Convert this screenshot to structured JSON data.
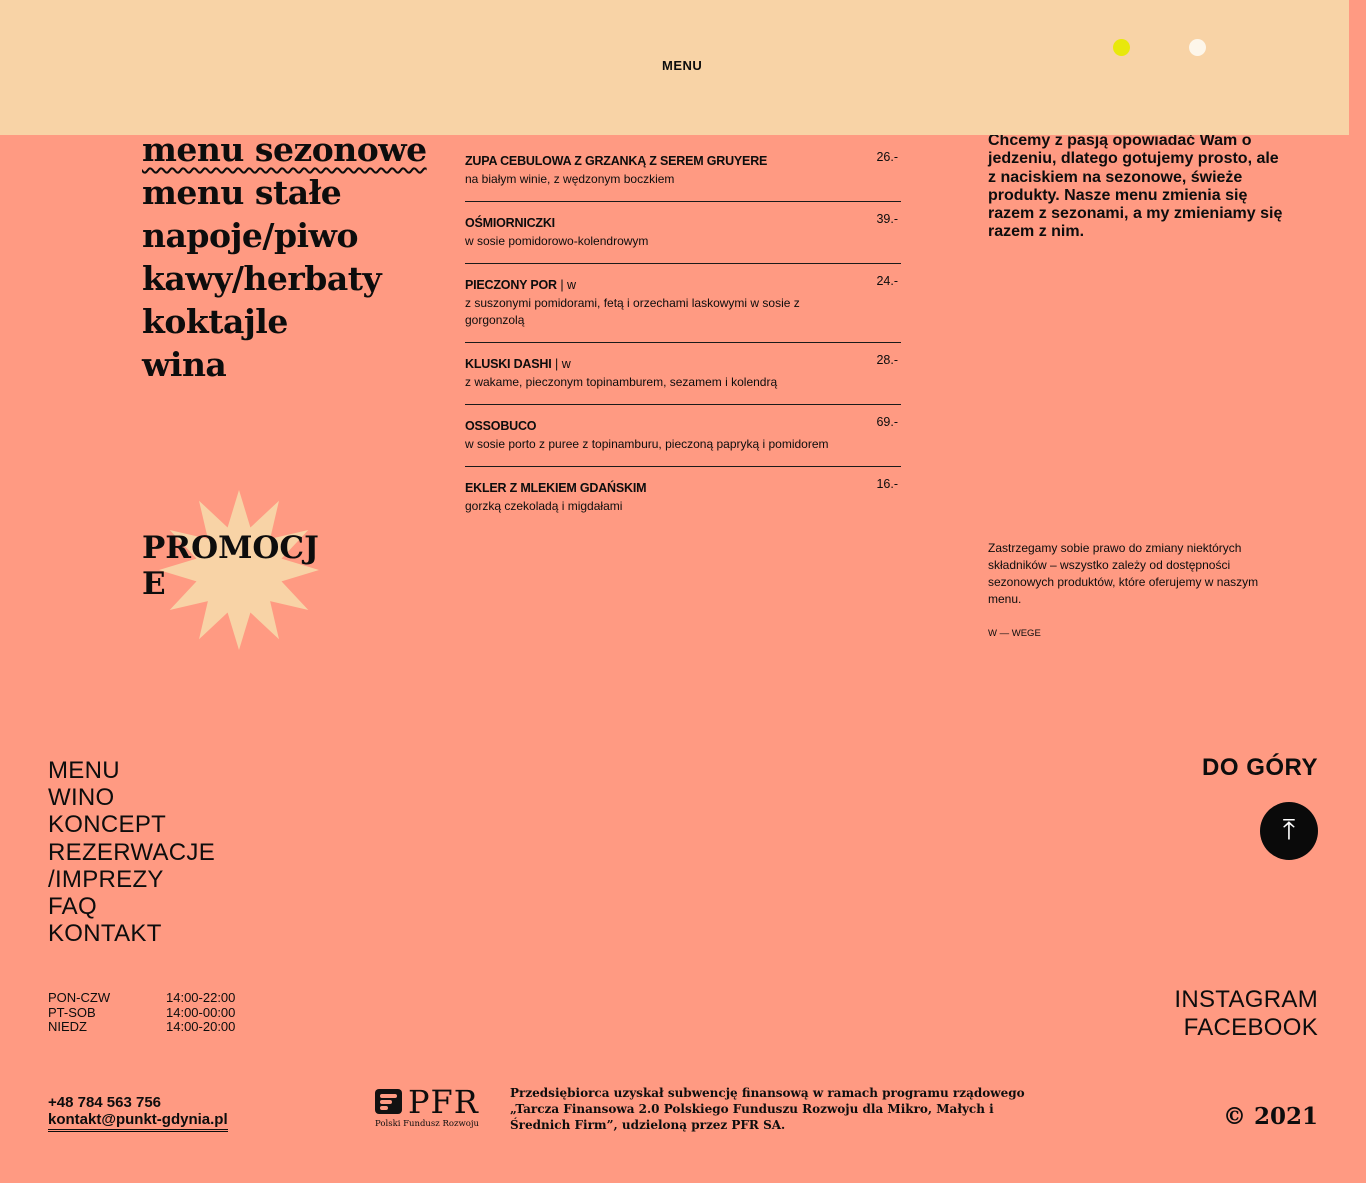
{
  "header": {
    "menu_label": "MENU",
    "accent_dot_color": "#e8e80c",
    "light_dot_color": "#fdf6ea"
  },
  "categories": [
    {
      "label": "menu sezonowe",
      "active": true
    },
    {
      "label": "menu stałe"
    },
    {
      "label": "napoje/piwo"
    },
    {
      "label": "kawy/herbaty"
    },
    {
      "label": "koktajle"
    },
    {
      "label": "wina"
    }
  ],
  "promo": {
    "label": "PROMOCJE",
    "badge_color": "#f8d3a6"
  },
  "dishes": [
    {
      "name": "ZUPA CEBULOWA Z GRZANKĄ Z SEREM GRUYERE",
      "tag": "",
      "desc": "na białym winie, z wędzonym boczkiem",
      "price": "26.-"
    },
    {
      "name": "OŚMIORNICZKI",
      "tag": "",
      "desc": "w sosie pomidorowo-kolendrowym",
      "price": "39.-"
    },
    {
      "name": "PIECZONY POR",
      "tag": " | w",
      "desc": "z suszonymi pomidorami, fetą i orzechami laskowymi w sosie z gorgonzolą",
      "price": "24.-"
    },
    {
      "name": "KLUSKI DASHI",
      "tag": " | w",
      "desc": "z wakame, pieczonym topinamburem, sezamem i kolendrą",
      "price": "28.-"
    },
    {
      "name": "OSSOBUCO",
      "tag": "",
      "desc": "w sosie porto z puree z topinamburu, pieczoną papryką i pomidorem",
      "price": "69.-"
    },
    {
      "name": "EKLER Z MLEKIEM GDAŃSKIM",
      "tag": "",
      "desc": "gorzką czekoladą i migdałami",
      "price": "16.-"
    }
  ],
  "intro": "Chcemy z pasją opowiadać Wam o jedzeniu, dlatego gotujemy prosto, ale z naciskiem na sezonowe, świeże produkty. Nasze menu zmienia się razem z sezonami, a my zmieniamy się razem z nim.",
  "note": "Zastrzegamy sobie prawo do zmiany niektórych składników – wszystko zależy od dostępności sezonowych produktów, które oferujemy w naszym menu.",
  "legend": "W — WEGE",
  "footer": {
    "nav": [
      "MENU",
      "WINO",
      "KONCEPT",
      "REZERWACJE",
      "/IMPREZY",
      "FAQ",
      "KONTAKT"
    ],
    "hours": [
      {
        "day": "PON-CZW",
        "time": "14:00-22:00"
      },
      {
        "day": "PT-SOB",
        "time": "14:00-00:00"
      },
      {
        "day": "NIEDZ",
        "time": "14:00-20:00"
      }
    ],
    "phone": "+48 784 563 756",
    "email": "kontakt@punkt-gdynia.pl",
    "pfr_logo_text": "PFR",
    "pfr_logo_sub": "Polski Fundusz Rozwoju",
    "grant_text": "Przedsiębiorca uzyskał subwencję finansową w ramach programu rządowego „Tarcza Finansowa 2.0 Polskiego Funduszu Rozwoju dla Mikro, Małych i Średnich Firm”, udzieloną przez PFR SA.",
    "to_top_label": "DO GÓRY",
    "to_top_icon": "arrow-up-icon",
    "social": [
      "INSTAGRAM",
      "FACEBOOK"
    ],
    "copyright": "© 2021"
  }
}
